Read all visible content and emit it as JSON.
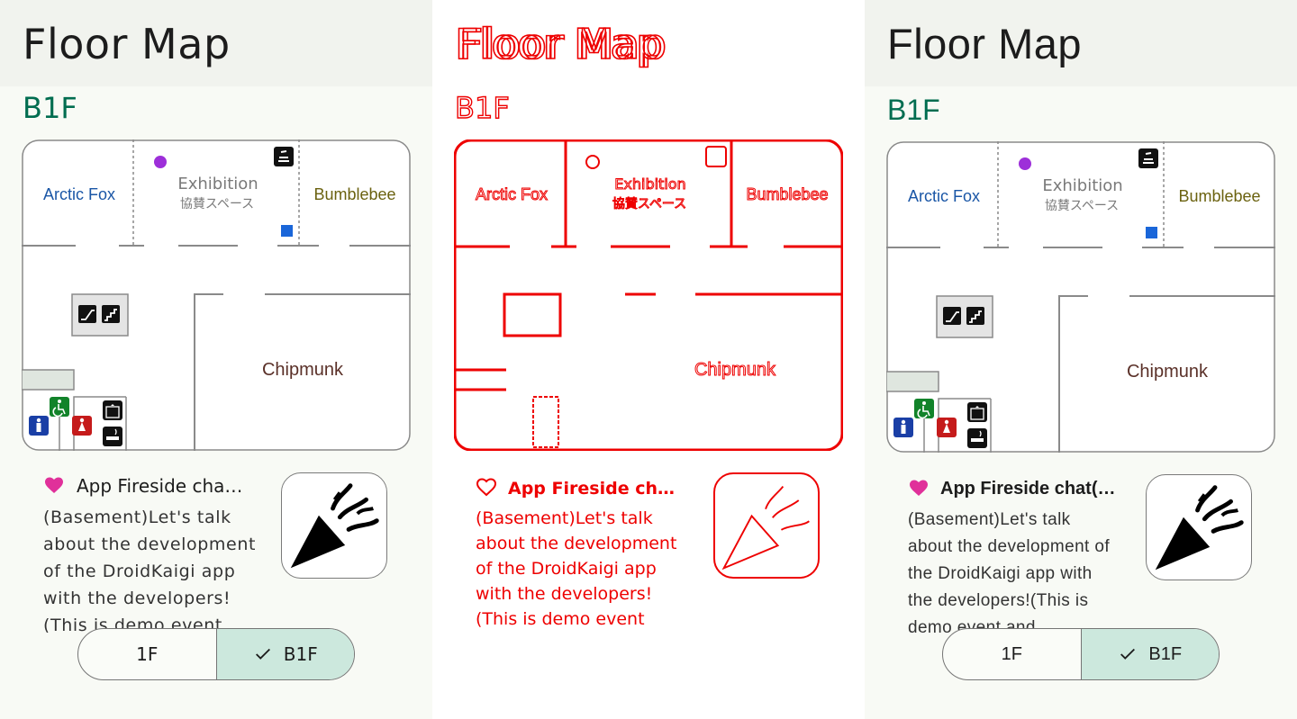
{
  "app": {
    "title": "Floor Map",
    "floor_label": "B1F"
  },
  "map": {
    "rooms": {
      "arctic_fox": "Arctic Fox",
      "exhibition": "Exhibition",
      "exhibition_jp": "協賛スペース",
      "bumblebee": "Bumblebee",
      "chipmunk": "Chipmunk"
    },
    "colors": {
      "arctic_fox": "#1a56a6",
      "bumblebee": "#6b6210",
      "chipmunk": "#5a3028",
      "exhibition": "#7a7a7a",
      "dot_purple": "#9d2fd9",
      "square_blue": "#1a66d9",
      "wheelchair_green": "#12832a",
      "male_blue": "#1a3fa6",
      "female_red": "#c51b1b"
    }
  },
  "event_card": {
    "title": "App Fireside chat(T…",
    "title_left": "App Fireside cha…",
    "description": "(Basement)Let's talk about the development of the DroidKaigi app with the developers!(This is demo event and",
    "heart_color": "#e0309a"
  },
  "floor_switch": {
    "options": [
      "1F",
      "B1F"
    ],
    "selected": "B1F",
    "selected_bg": "#cce8dd"
  },
  "debug_color": "#ee0000"
}
